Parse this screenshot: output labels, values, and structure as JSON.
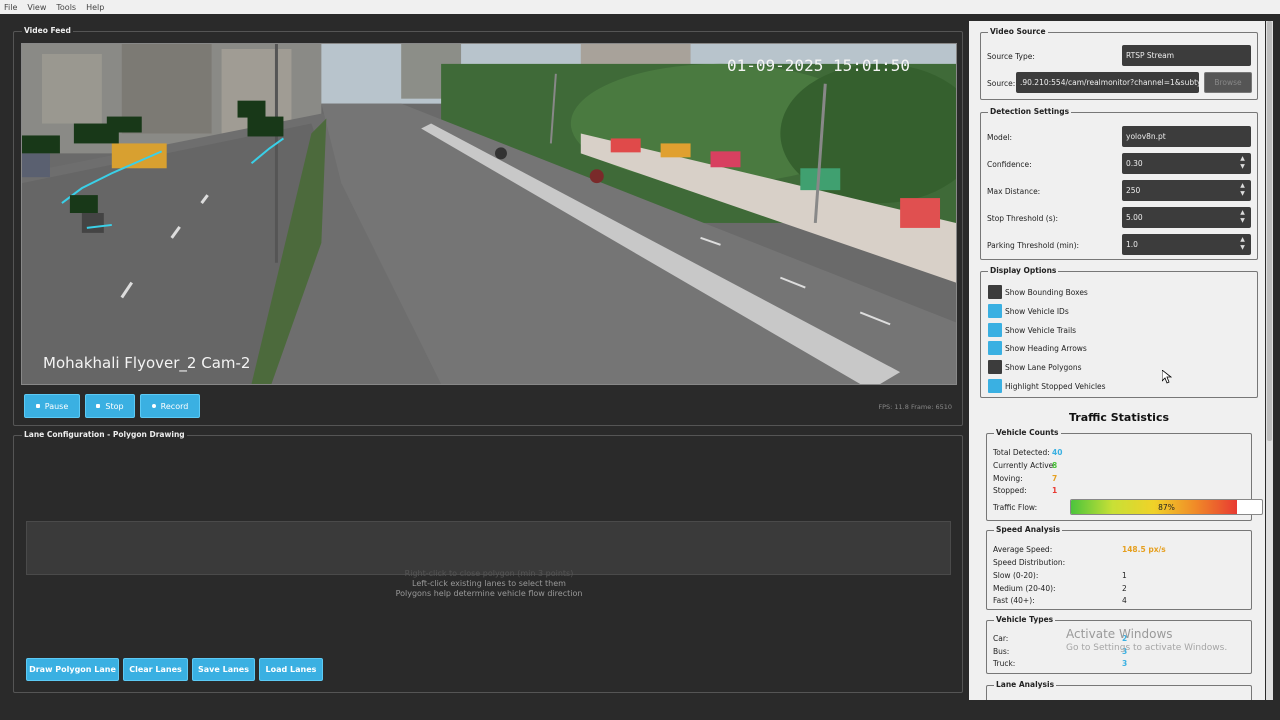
{
  "menu": [
    "File",
    "View",
    "Tools",
    "Help"
  ],
  "video": {
    "title": "Video Feed",
    "timestamp": "01-09-2025 15:01:50",
    "camera_label": "Mohakhali Flyover_2 Cam-2",
    "buttons": [
      "Pause",
      "Stop",
      "Record"
    ],
    "fps_text": "FPS: 11.8  Frame: 6510"
  },
  "lane": {
    "title": "Lane Configuration - Polygon Drawing",
    "hints": [
      "Right-click to close polygon (min 3 points)",
      "Left-click existing lanes to select them",
      "Polygons help determine vehicle flow direction"
    ],
    "buttons": [
      "Draw Polygon Lane",
      "Clear Lanes",
      "Save Lanes",
      "Load Lanes"
    ]
  },
  "video_source": {
    "title": "Video Source",
    "source_type_label": "Source Type:",
    "source_type_value": "RTSP Stream",
    "source_label": "Source:",
    "source_value": ".90.210:554/cam/realmonitor?channel=1&subtype=0",
    "browse_label": "Browse"
  },
  "detection": {
    "title": "Detection Settings",
    "fields": [
      {
        "label": "Model:",
        "value": "yolov8n.pt"
      },
      {
        "label": "Confidence:",
        "value": "0.30"
      },
      {
        "label": "Max Distance:",
        "value": "250"
      },
      {
        "label": "Stop Threshold (s):",
        "value": "5.00"
      },
      {
        "label": "Parking Threshold (min):",
        "value": "1.0"
      }
    ]
  },
  "display": {
    "title": "Display Options",
    "options": [
      {
        "label": "Show Bounding Boxes",
        "checked": false
      },
      {
        "label": "Show Vehicle IDs",
        "checked": true
      },
      {
        "label": "Show Vehicle Trails",
        "checked": true
      },
      {
        "label": "Show Heading Arrows",
        "checked": true
      },
      {
        "label": "Show Lane Polygons",
        "checked": false
      },
      {
        "label": "Highlight Stopped Vehicles",
        "checked": true
      }
    ]
  },
  "stats": {
    "title": "Traffic Statistics",
    "counts": {
      "title": "Vehicle Counts",
      "total_label": "Total Detected:",
      "total": "40",
      "active_label": "Currently Active:",
      "active": "8",
      "moving_label": "Moving:",
      "moving": "7",
      "stopped_label": "Stopped:",
      "stopped": "1",
      "flow_label": "Traffic Flow:",
      "flow_text": "87%",
      "flow_value": 0.87
    },
    "speed": {
      "title": "Speed Analysis",
      "avg_label": "Average Speed:",
      "avg": "148.5 px/s",
      "dist_label": "Speed Distribution:",
      "slow_label": "Slow (0-20):",
      "slow": "1",
      "medium_label": "Medium (20-40):",
      "medium": "2",
      "fast_label": "Fast (40+):",
      "fast": "4"
    },
    "types": {
      "title": "Vehicle Types",
      "car_label": "Car:",
      "car": "2",
      "bus_label": "Bus:",
      "bus": "3",
      "truck_label": "Truck:",
      "truck": "3"
    },
    "lane_analysis_title": "Lane Analysis"
  },
  "watermark": {
    "line1": "Activate Windows",
    "line2": "Go to Settings to activate Windows."
  },
  "colors": {
    "accent": "#3ab0e2",
    "total": "#3ab0e2",
    "active": "#4cc43c",
    "moving": "#e6a020",
    "stopped": "#e83a32",
    "avg_speed": "#e6a020"
  }
}
